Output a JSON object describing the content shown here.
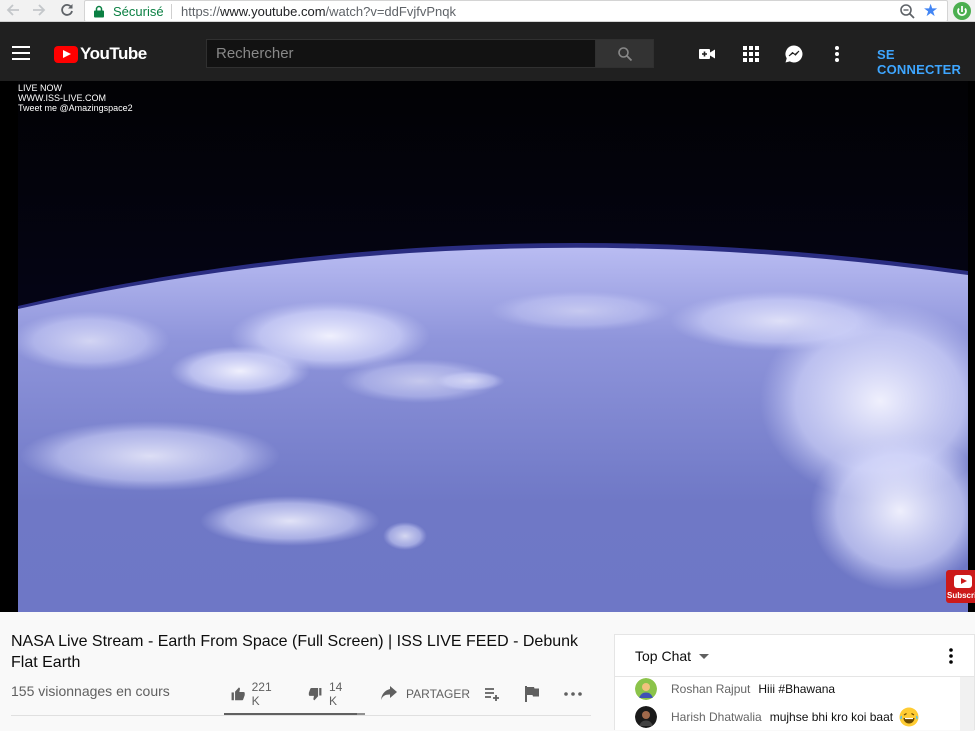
{
  "browser": {
    "secure_label": "Sécurisé",
    "url_prefix": "https://",
    "url_host": "www.youtube.com",
    "url_path": "/watch?v=ddFvjfvPnqk",
    "icons": [
      "back-arrow-icon",
      "forward-arrow-icon",
      "reload-icon",
      "lock-icon",
      "zoom-icon",
      "bookmark-star-icon",
      "extension-icon"
    ]
  },
  "masthead": {
    "logo_text": "YouTube",
    "search_placeholder": "Rechercher",
    "signin_label": "SE CONNECTER",
    "icons": [
      "guide-menu-icon",
      "youtube-logo-icon",
      "search-icon",
      "create-video-icon",
      "apps-grid-icon",
      "messages-icon",
      "more-vert-icon"
    ],
    "accent": "#3ea6ff",
    "brand_red": "#ff0000"
  },
  "player": {
    "overlay_line1": "LIVE NOW",
    "overlay_line2": "WWW.ISS-LIVE.COM",
    "overlay_line3": "Tweet me @Amazingspace2",
    "subscribe_label": "Subscribe"
  },
  "video": {
    "title": "NASA Live Stream - Earth From Space (Full Screen) | ISS LIVE FEED - Debunk Flat Earth",
    "views": "155 visionnages en cours",
    "likes": "221 K",
    "dislikes": "14 K",
    "share_label": "PARTAGER",
    "like_ratio": 0.94
  },
  "chat": {
    "mode_label": "Top Chat",
    "messages": [
      {
        "author": "Roshan Rajput",
        "text": "Hiii #Bhawana"
      },
      {
        "author": "Harish Dhatwalia",
        "text": "mujhse bhi kro koi baat"
      }
    ]
  }
}
